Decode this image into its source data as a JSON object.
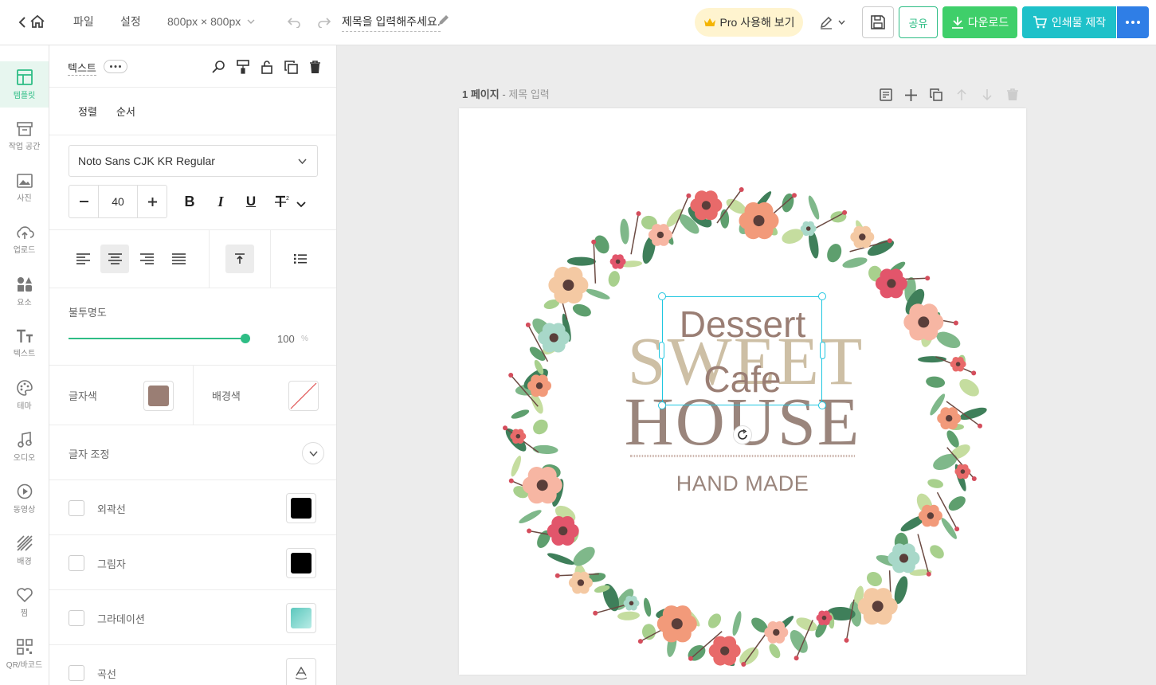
{
  "topbar": {
    "file_menu": "파일",
    "settings_menu": "설정",
    "canvas_size": "800px × 800px",
    "doc_title_placeholder": "제목을 입력해주세요.",
    "pro_button": "Pro 사용해 보기",
    "share_button": "공유",
    "download_button": "다운로드",
    "print_button": "인쇄물 제작"
  },
  "leftnav": {
    "items": [
      {
        "label": "템플릿",
        "icon": "template-icon"
      },
      {
        "label": "작업 공간",
        "icon": "workspace-icon"
      },
      {
        "label": "사진",
        "icon": "photo-icon"
      },
      {
        "label": "업로드",
        "icon": "upload-icon"
      },
      {
        "label": "요소",
        "icon": "elements-icon"
      },
      {
        "label": "텍스트",
        "icon": "text-icon"
      },
      {
        "label": "테마",
        "icon": "palette-icon"
      },
      {
        "label": "오디오",
        "icon": "music-icon"
      },
      {
        "label": "동영상",
        "icon": "video-icon"
      },
      {
        "label": "배경",
        "icon": "background-icon"
      },
      {
        "label": "찜",
        "icon": "heart-icon"
      },
      {
        "label": "QR/바코드",
        "icon": "qr-icon"
      }
    ]
  },
  "panel": {
    "header_title": "텍스트",
    "tabs": [
      "정렬",
      "순서"
    ],
    "font_family": "Noto Sans CJK KR Regular",
    "font_size": "40",
    "opacity_label": "불투명도",
    "opacity_value": "100",
    "opacity_unit": "%",
    "text_color_label": "글자색",
    "text_color": "#9a7e74",
    "bg_color_label": "배경색",
    "letter_adjust_label": "글자 조정",
    "effects": [
      {
        "label": "외곽선",
        "color": "#000000"
      },
      {
        "label": "그림자",
        "color": "#000000"
      },
      {
        "label": "그라데이션",
        "color": "#7fd3c9"
      },
      {
        "label": "곡선"
      }
    ]
  },
  "canvas": {
    "page_label": "1 페이지",
    "page_title_placeholder": "제목 입력",
    "design": {
      "dessert": "Dessert",
      "sweet": "SWEET",
      "cafe": "Cafe",
      "house": "HOUSE",
      "handmade": "HAND MADE"
    }
  },
  "colors": {
    "accent_green": "#2ebd85",
    "download_green": "#3fcf6a",
    "print_cyan": "#1ec1c9",
    "more_blue": "#2f7ee6",
    "pro_bg": "#fff4cf",
    "selection": "#1fc6e0"
  }
}
